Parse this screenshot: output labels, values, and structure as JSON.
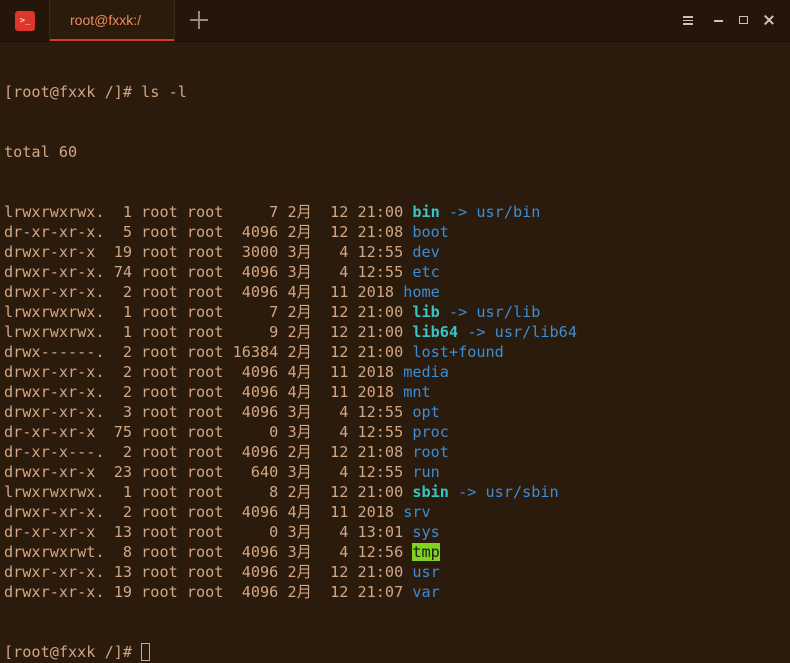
{
  "window": {
    "tab_title": "root@fxxk:/",
    "app_icon_glyph": ">_",
    "colors": {
      "background": "#2a1b0d",
      "text": "#d4a582",
      "directory": "#3b8dd6",
      "symlink": "#35c7c7",
      "sticky_highlight": "#7fd21d",
      "accent": "#e0352b"
    }
  },
  "terminal": {
    "command_line": "[root@fxxk /]# ls -l",
    "total": "total 60",
    "entries": [
      {
        "meta": "lrwxrwxrwx.  1 root root     7 2月  12 21:00 ",
        "name": "bin",
        "arrow": " -> ",
        "target": "usr/bin",
        "kind": "link"
      },
      {
        "meta": "dr-xr-xr-x.  5 root root  4096 2月  12 21:08 ",
        "name": "boot",
        "kind": "dir"
      },
      {
        "meta": "drwxr-xr-x  19 root root  3000 3月   4 12:55 ",
        "name": "dev",
        "kind": "dir"
      },
      {
        "meta": "drwxr-xr-x. 74 root root  4096 3月   4 12:55 ",
        "name": "etc",
        "kind": "dir"
      },
      {
        "meta": "drwxr-xr-x.  2 root root  4096 4月  11 2018 ",
        "name": "home",
        "kind": "dir"
      },
      {
        "meta": "lrwxrwxrwx.  1 root root     7 2月  12 21:00 ",
        "name": "lib",
        "arrow": " -> ",
        "target": "usr/lib",
        "kind": "link"
      },
      {
        "meta": "lrwxrwxrwx.  1 root root     9 2月  12 21:00 ",
        "name": "lib64",
        "arrow": " -> ",
        "target": "usr/lib64",
        "kind": "link"
      },
      {
        "meta": "drwx------.  2 root root 16384 2月  12 21:00 ",
        "name": "lost+found",
        "kind": "dir"
      },
      {
        "meta": "drwxr-xr-x.  2 root root  4096 4月  11 2018 ",
        "name": "media",
        "kind": "dir"
      },
      {
        "meta": "drwxr-xr-x.  2 root root  4096 4月  11 2018 ",
        "name": "mnt",
        "kind": "dir"
      },
      {
        "meta": "drwxr-xr-x.  3 root root  4096 3月   4 12:55 ",
        "name": "opt",
        "kind": "dir"
      },
      {
        "meta": "dr-xr-xr-x  75 root root     0 3月   4 12:55 ",
        "name": "proc",
        "kind": "dir"
      },
      {
        "meta": "dr-xr-x---.  2 root root  4096 2月  12 21:08 ",
        "name": "root",
        "kind": "dir"
      },
      {
        "meta": "drwxr-xr-x  23 root root   640 3月   4 12:55 ",
        "name": "run",
        "kind": "dir"
      },
      {
        "meta": "lrwxrwxrwx.  1 root root     8 2月  12 21:00 ",
        "name": "sbin",
        "arrow": " -> ",
        "target": "usr/sbin",
        "kind": "link"
      },
      {
        "meta": "drwxr-xr-x.  2 root root  4096 4月  11 2018 ",
        "name": "srv",
        "kind": "dir"
      },
      {
        "meta": "dr-xr-xr-x  13 root root     0 3月   4 13:01 ",
        "name": "sys",
        "kind": "dir"
      },
      {
        "meta": "drwxrwxrwt.  8 root root  4096 3月   4 12:56 ",
        "name": "tmp",
        "kind": "sticky"
      },
      {
        "meta": "drwxr-xr-x. 13 root root  4096 2月  12 21:00 ",
        "name": "usr",
        "kind": "dir"
      },
      {
        "meta": "drwxr-xr-x. 19 root root  4096 2月  12 21:07 ",
        "name": "var",
        "kind": "dir"
      }
    ],
    "prompt": "[root@fxxk /]# "
  }
}
